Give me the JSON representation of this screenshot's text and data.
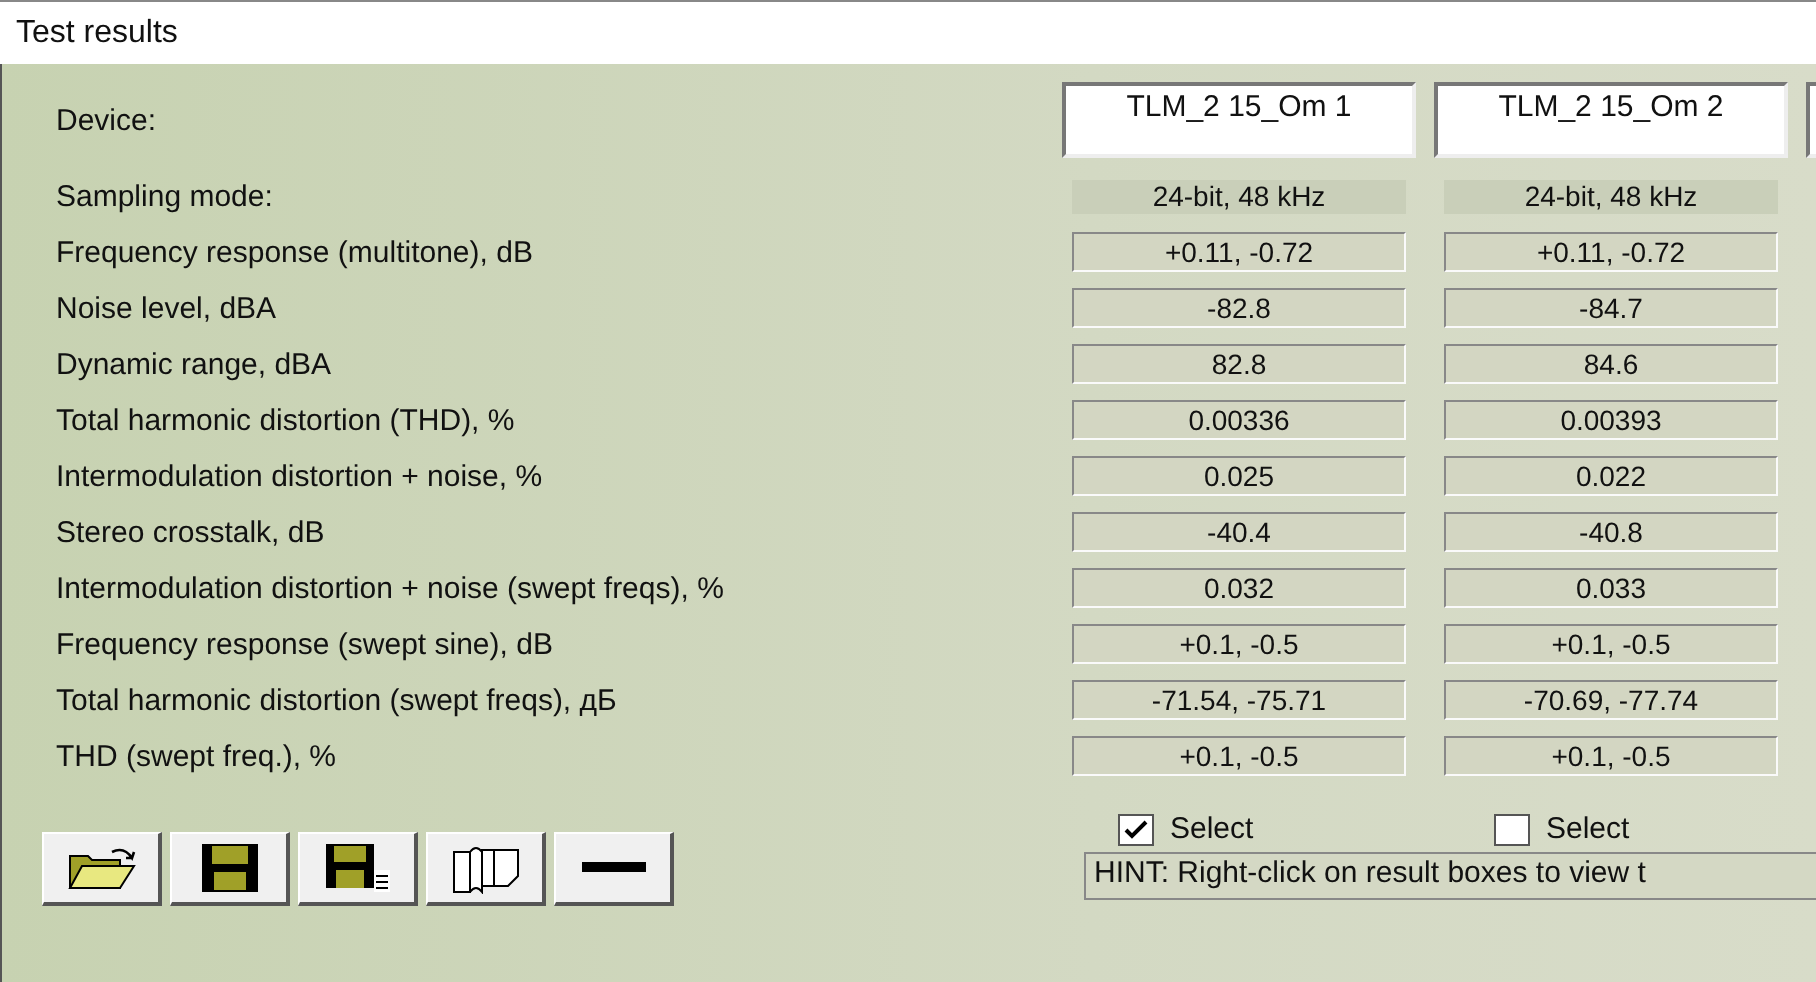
{
  "window": {
    "title": "Test results"
  },
  "row_labels": {
    "device": "Device:",
    "sampling": "Sampling mode:"
  },
  "devices": [
    {
      "name": "TLM_2 15_Om 1",
      "sampling_mode": "24-bit, 48 kHz",
      "select": {
        "label": "Select",
        "checked": true
      }
    },
    {
      "name": "TLM_2 15_Om 2",
      "sampling_mode": "24-bit, 48 kHz",
      "select": {
        "label": "Select",
        "checked": false
      }
    }
  ],
  "metrics": [
    {
      "label": "Frequency response (multitone), dB",
      "values": [
        "+0.11, -0.72",
        "+0.11, -0.72"
      ]
    },
    {
      "label": "Noise level, dBA",
      "values": [
        "-82.8",
        "-84.7"
      ]
    },
    {
      "label": "Dynamic range, dBA",
      "values": [
        "82.8",
        "84.6"
      ]
    },
    {
      "label": "Total harmonic distortion (THD), %",
      "values": [
        "0.00336",
        "0.00393"
      ]
    },
    {
      "label": "Intermodulation distortion + noise, %",
      "values": [
        "0.025",
        "0.022"
      ]
    },
    {
      "label": "Stereo crosstalk, dB",
      "values": [
        "-40.4",
        "-40.8"
      ]
    },
    {
      "label": "Intermodulation distortion + noise (swept freqs), %",
      "values": [
        "0.032",
        "0.033"
      ]
    },
    {
      "label": "Frequency response (swept sine), dB",
      "values": [
        "+0.1, -0.5",
        "+0.1, -0.5"
      ]
    },
    {
      "label": "Total harmonic distortion (swept freqs), дБ",
      "values": [
        "-71.54, -75.71",
        "-70.69, -77.74"
      ]
    },
    {
      "label": "THD (swept freq.), %",
      "values": [
        "+0.1, -0.5",
        "+0.1, -0.5"
      ]
    }
  ],
  "toolbar": [
    {
      "kind": "open"
    },
    {
      "kind": "save"
    },
    {
      "kind": "save-list"
    },
    {
      "kind": "copy"
    },
    {
      "kind": "remove"
    }
  ],
  "hint": "HINT: Right-click on result boxes to view t"
}
